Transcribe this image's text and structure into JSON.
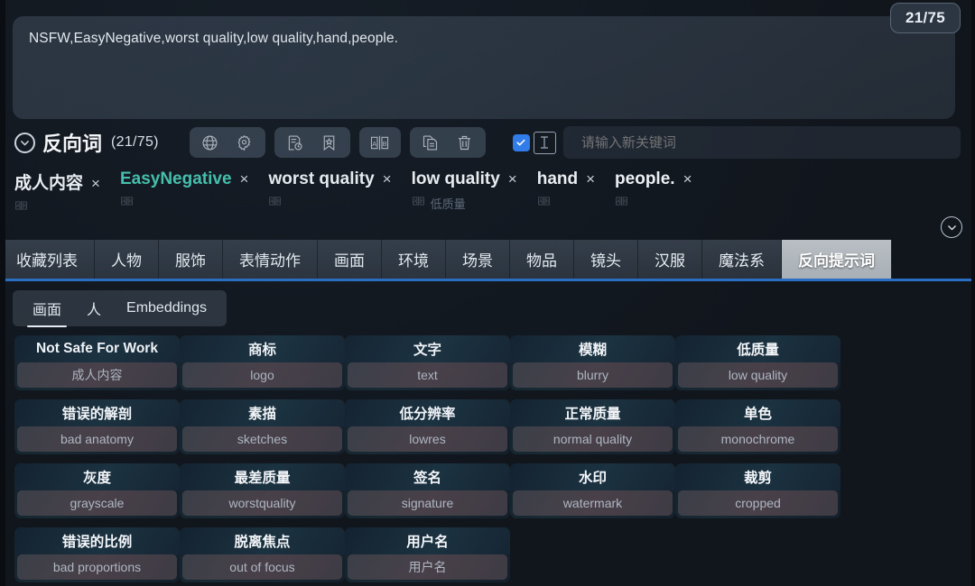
{
  "counter_badge": "21/75",
  "prompt": {
    "text": "NSFW,EasyNegative,worst quality,low quality,hand,people."
  },
  "negative_header": {
    "title": "反向词",
    "count": "(21/75)",
    "icon_groups": [
      {
        "icons": [
          {
            "name": "globe-icon"
          },
          {
            "name": "gear-icon"
          }
        ]
      },
      {
        "icons": [
          {
            "name": "history-icon"
          },
          {
            "name": "bookmark-star-icon"
          }
        ]
      },
      {
        "icons": [
          {
            "name": "translate-ab-icon"
          }
        ]
      },
      {
        "icons": [
          {
            "name": "copy-icon"
          },
          {
            "name": "trash-icon"
          }
        ]
      }
    ],
    "keyword_checkbox_checked": true,
    "keyword_placeholder": "请输入新关键词"
  },
  "tags": [
    {
      "label": "成人内容",
      "teal": false,
      "sub": "",
      "close": "×"
    },
    {
      "label": "EasyNegative",
      "teal": true,
      "sub": "",
      "close": "×"
    },
    {
      "label": "worst quality",
      "teal": false,
      "sub": "",
      "close": "×"
    },
    {
      "label": "low quality",
      "teal": false,
      "sub": "低质量",
      "close": "×"
    },
    {
      "label": "hand",
      "teal": false,
      "sub": "",
      "close": "×"
    },
    {
      "label": "people.",
      "teal": false,
      "sub": "",
      "close": "×"
    }
  ],
  "tabs": [
    {
      "label": "收藏列表",
      "active": false
    },
    {
      "label": "人物",
      "active": false
    },
    {
      "label": "服饰",
      "active": false
    },
    {
      "label": "表情动作",
      "active": false
    },
    {
      "label": "画面",
      "active": false
    },
    {
      "label": "环境",
      "active": false
    },
    {
      "label": "场景",
      "active": false
    },
    {
      "label": "物品",
      "active": false
    },
    {
      "label": "镜头",
      "active": false
    },
    {
      "label": "汉服",
      "active": false
    },
    {
      "label": "魔法系",
      "active": false
    },
    {
      "label": "反向提示词",
      "active": true
    }
  ],
  "subtabs": [
    {
      "label": "画面",
      "active": true
    },
    {
      "label": "人",
      "active": false
    },
    {
      "label": "Embeddings",
      "active": false
    }
  ],
  "cards": [
    {
      "title": "Not Safe For Work",
      "sub": "成人内容"
    },
    {
      "title": "商标",
      "sub": "logo"
    },
    {
      "title": "文字",
      "sub": "text"
    },
    {
      "title": "模糊",
      "sub": "blurry"
    },
    {
      "title": "低质量",
      "sub": "low quality"
    },
    {
      "title": "错误的解剖",
      "sub": "bad anatomy"
    },
    {
      "title": "素描",
      "sub": "sketches"
    },
    {
      "title": "低分辨率",
      "sub": "lowres"
    },
    {
      "title": "正常质量",
      "sub": "normal quality"
    },
    {
      "title": "单色",
      "sub": "monochrome"
    },
    {
      "title": "灰度",
      "sub": "grayscale"
    },
    {
      "title": "最差质量",
      "sub": "worstquality"
    },
    {
      "title": "签名",
      "sub": "signature"
    },
    {
      "title": "水印",
      "sub": "watermark"
    },
    {
      "title": "裁剪",
      "sub": "cropped"
    },
    {
      "title": "错误的比例",
      "sub": "bad proportions"
    },
    {
      "title": "脱离焦点",
      "sub": "out of focus"
    },
    {
      "title": "用户名",
      "sub": "用户名"
    }
  ],
  "colors": {
    "accent_blue": "#2f7ff0",
    "tab_underline": "#2a6fc4",
    "tag_teal": "#46c6b0",
    "background": "#11161d"
  }
}
